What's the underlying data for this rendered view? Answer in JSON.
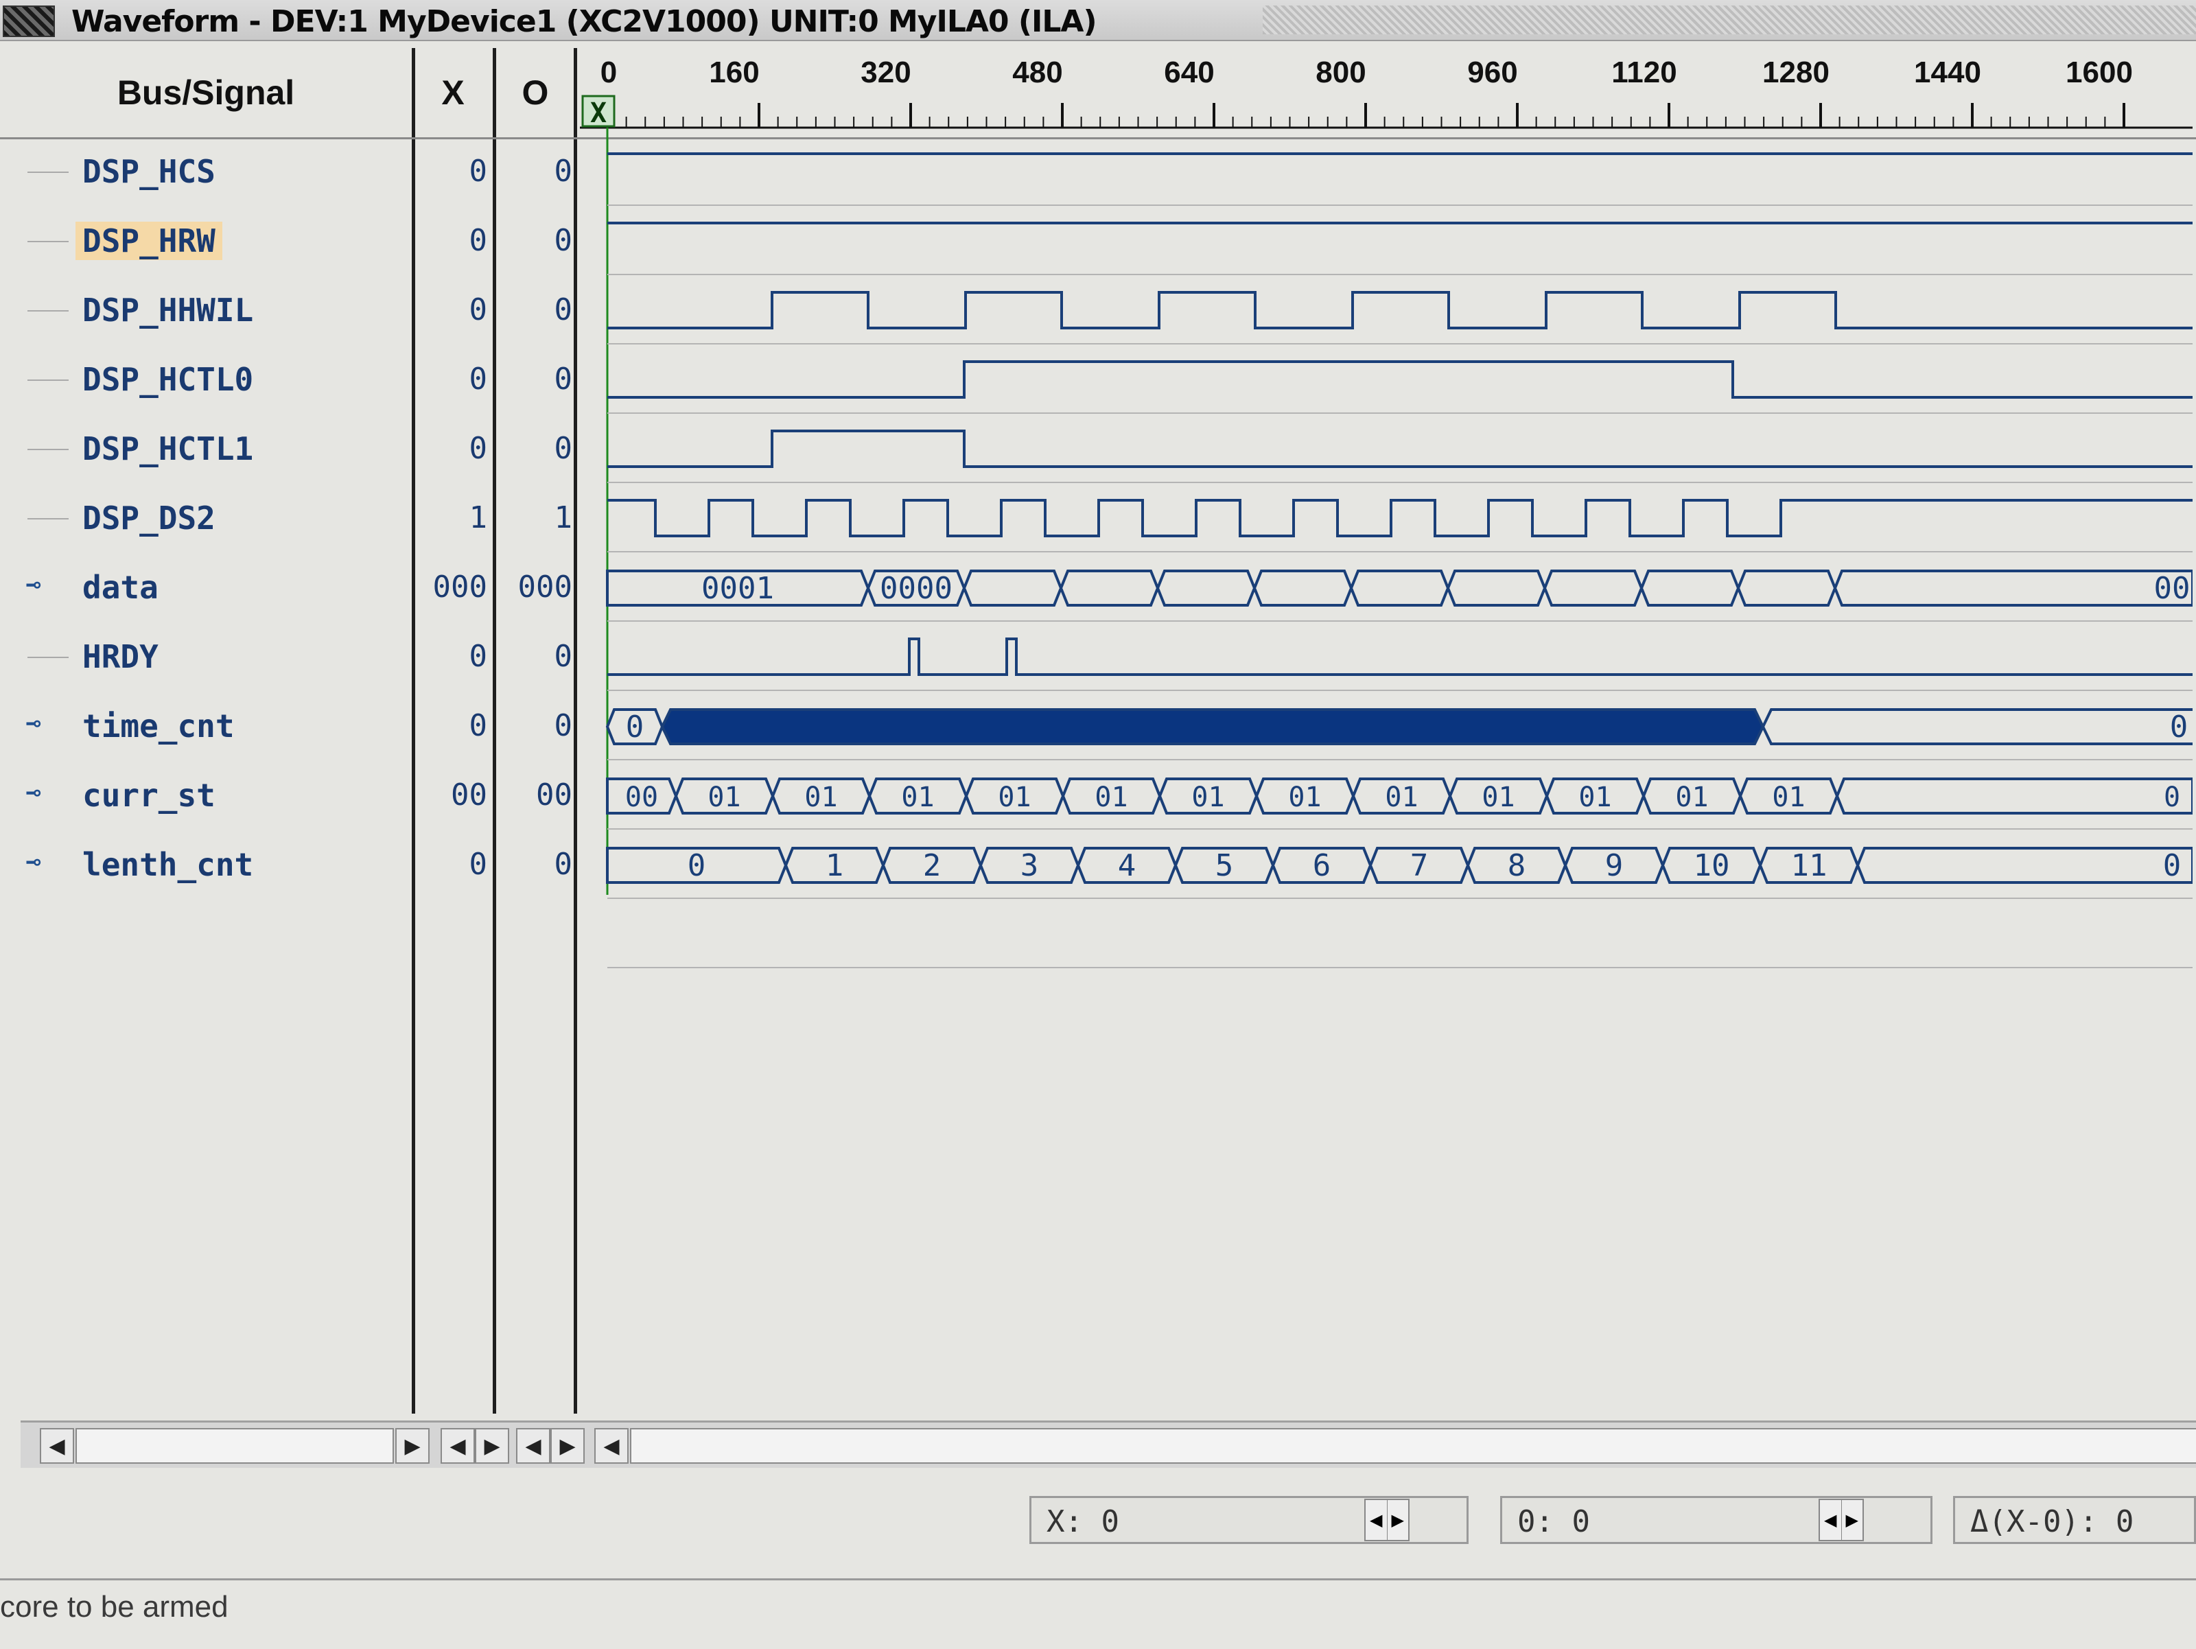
{
  "window": {
    "title": "Waveform - DEV:1 MyDevice1 (XC2V1000) UNIT:0 MyILA0 (ILA)"
  },
  "columns": {
    "signal": "Bus/Signal",
    "x": "X",
    "o": "O"
  },
  "timeline": {
    "ticks": [
      "0",
      "160",
      "320",
      "480",
      "640",
      "800",
      "960",
      "1120",
      "1280",
      "1440",
      "1600"
    ],
    "cursor_label": "X"
  },
  "signals": [
    {
      "name": "DSP_HCS",
      "x": "0",
      "o": "0",
      "bus": false,
      "selected": false
    },
    {
      "name": "DSP_HRW",
      "x": "0",
      "o": "0",
      "bus": false,
      "selected": true
    },
    {
      "name": "DSP_HHWIL",
      "x": "0",
      "o": "0",
      "bus": false,
      "selected": false
    },
    {
      "name": "DSP_HCTL0",
      "x": "0",
      "o": "0",
      "bus": false,
      "selected": false
    },
    {
      "name": "DSP_HCTL1",
      "x": "0",
      "o": "0",
      "bus": false,
      "selected": false
    },
    {
      "name": "DSP_DS2",
      "x": "1",
      "o": "1",
      "bus": false,
      "selected": false
    },
    {
      "name": "data",
      "x": "000",
      "o": "000",
      "bus": true,
      "selected": false
    },
    {
      "name": "HRDY",
      "x": "0",
      "o": "0",
      "bus": false,
      "selected": false
    },
    {
      "name": "time_cnt",
      "x": "0",
      "o": "0",
      "bus": true,
      "selected": false
    },
    {
      "name": "curr_st",
      "x": "00",
      "o": "00",
      "bus": true,
      "selected": false
    },
    {
      "name": "lenth_cnt",
      "x": "0",
      "o": "0",
      "bus": true,
      "selected": false
    }
  ],
  "waves": {
    "data_labels": [
      "0001",
      "0000",
      "00"
    ],
    "time_cnt_labels": [
      "0",
      "0"
    ],
    "curr_st_labels": [
      "00",
      "01",
      "01",
      "01",
      "01",
      "01",
      "01",
      "01",
      "01",
      "01",
      "01",
      "01",
      "01",
      "0"
    ],
    "lenth_cnt_labels": [
      "0",
      "1",
      "2",
      "3",
      "4",
      "5",
      "6",
      "7",
      "8",
      "9",
      "10",
      "11",
      "0"
    ]
  },
  "status": {
    "x_readout": "X: 0",
    "o_readout": "0: 0",
    "delta_readout": "Δ(X-0): 0",
    "footer_message": "core to be armed"
  },
  "colors": {
    "wave": "#1a3f78",
    "label": "#1a3a70",
    "background": "#e6e6e2",
    "selected": "#f5d9a7",
    "cursor": "#1e8a1e"
  }
}
